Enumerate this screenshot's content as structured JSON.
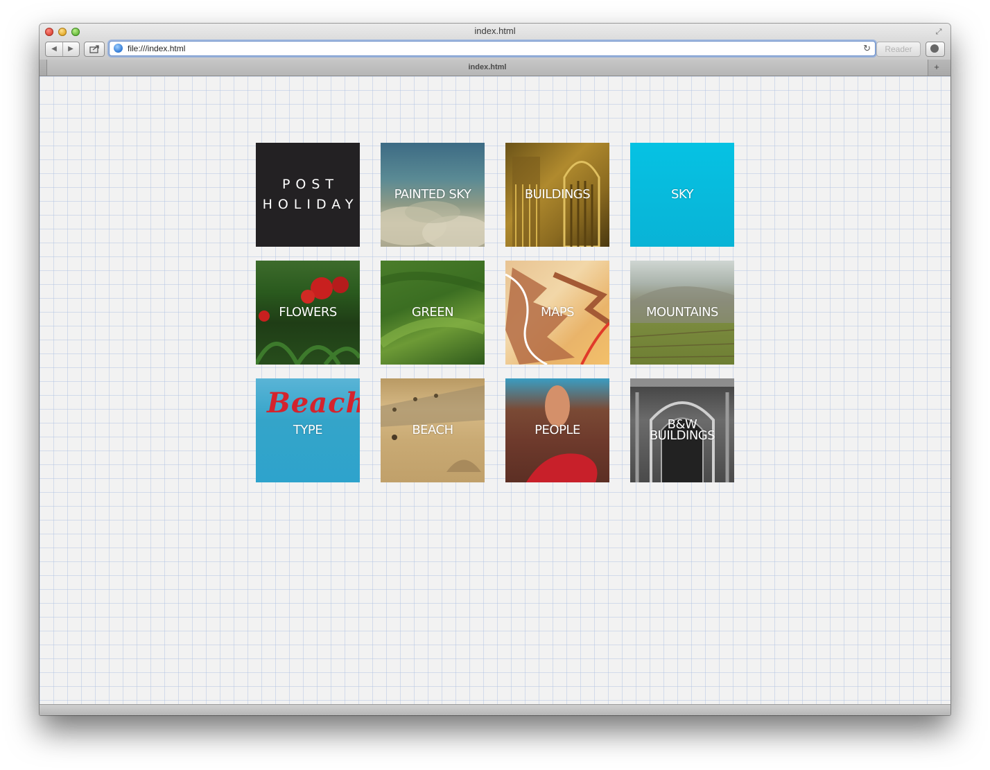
{
  "browser": {
    "window_title": "index.html",
    "address": "file:///index.html",
    "reader_label": "Reader",
    "tab_label": "index.html",
    "newtab_label": "+",
    "back_glyph": "◀",
    "forward_glyph": "▶",
    "fullscreen_glyph": "⤢",
    "reload_glyph": "↻"
  },
  "tiles": [
    {
      "label": "POST\nHOLIDAY",
      "kind": "logo"
    },
    {
      "label": "PAINTED SKY"
    },
    {
      "label": "BUILDINGS"
    },
    {
      "label": "SKY"
    },
    {
      "label": "FLOWERS"
    },
    {
      "label": "GREEN"
    },
    {
      "label": "MAPS"
    },
    {
      "label": "MOUNTAINS"
    },
    {
      "label": "TYPE",
      "script": "Beach"
    },
    {
      "label": "BEACH"
    },
    {
      "label": "PEOPLE"
    },
    {
      "label": "B&W\nBUILDINGS"
    }
  ],
  "colors": {
    "logo_bg": "#232123",
    "sky_cyan": "#06bde0",
    "beach_script": "#d4232d"
  }
}
